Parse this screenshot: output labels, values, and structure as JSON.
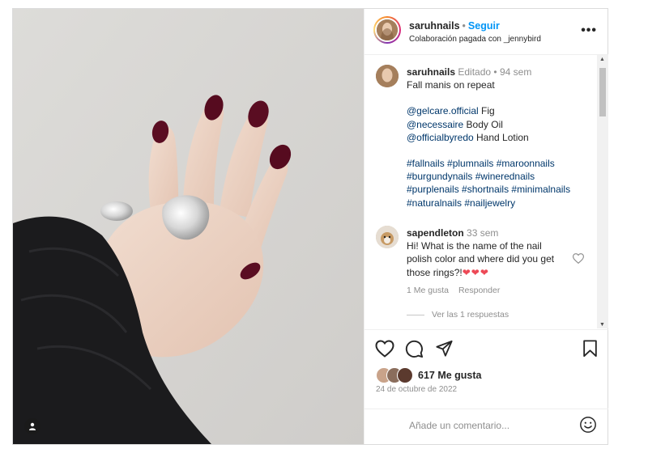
{
  "header": {
    "username": "saruhnails",
    "dot": "•",
    "follow_label": "Seguir",
    "subtitle": "Colaboración pagada con _jennybird",
    "more_label": "•••"
  },
  "caption": {
    "username": "saruhnails",
    "edited": "Editado",
    "dot": "•",
    "time": "94 sem",
    "title": "Fall manis on repeat",
    "products": [
      {
        "handle": "@gelcare.official",
        "text": " Fig"
      },
      {
        "handle": "@necessaire",
        "text": " Body Oil"
      },
      {
        "handle": "@officialbyredo",
        "text": " Hand Lotion"
      }
    ],
    "hashtag_lines": [
      "#fallnails #plumnails #maroonnails",
      "#burgundynails #winerednails",
      "#purplenails #shortnails #minimalnails",
      "#naturalnails #nailjewelry"
    ]
  },
  "comment": {
    "username": "sapendleton",
    "time": "33 sem",
    "text": "Hi! What is the name of the nail polish color and where did you get those rings?!",
    "emoji": "❤❤❤",
    "likes": "1 Me gusta",
    "reply_label": "Responder",
    "view_replies": "Ver las 1 respuestas"
  },
  "stats": {
    "likes": "617 Me gusta",
    "date": "24 de octubre de 2022"
  },
  "add_comment": {
    "placeholder": "Añade un comentario..."
  },
  "colors": {
    "link": "#00376b",
    "follow": "#0095f6",
    "heart": "#ed4956"
  }
}
